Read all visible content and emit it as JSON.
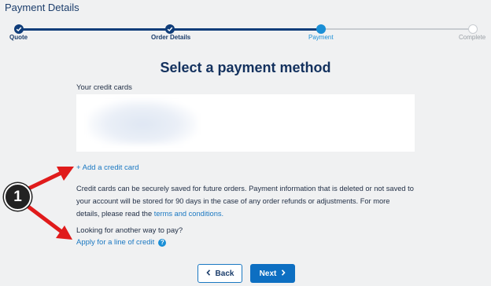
{
  "page_title": "Payment Details",
  "stepper": {
    "steps": [
      {
        "label": "Quote",
        "state": "done"
      },
      {
        "label": "Order Details",
        "state": "done"
      },
      {
        "label": "Payment",
        "state": "active"
      },
      {
        "label": "Complete",
        "state": "todo"
      }
    ]
  },
  "heading": "Select a payment method",
  "cards": {
    "label": "Your credit cards",
    "add_link": "+ Add a credit card"
  },
  "info": {
    "text": "Credit cards can be securely saved for future orders. Payment information that is deleted or not saved to your account will be stored for 90 days in the case of any order refunds or adjustments. For more details, please read the",
    "link": "terms and conditions."
  },
  "other": {
    "label": "Looking for another way to pay?",
    "link": "Apply for a line of credit",
    "help_icon": "question-circle-icon"
  },
  "buttons": {
    "back_label": "Back",
    "next_label": "Next"
  },
  "annotation": {
    "marker_number": "1"
  },
  "colors": {
    "primary": "#0f3d7a",
    "active": "#1a8fd6",
    "link": "#1a78c2",
    "arrow": "#e01b1b"
  }
}
